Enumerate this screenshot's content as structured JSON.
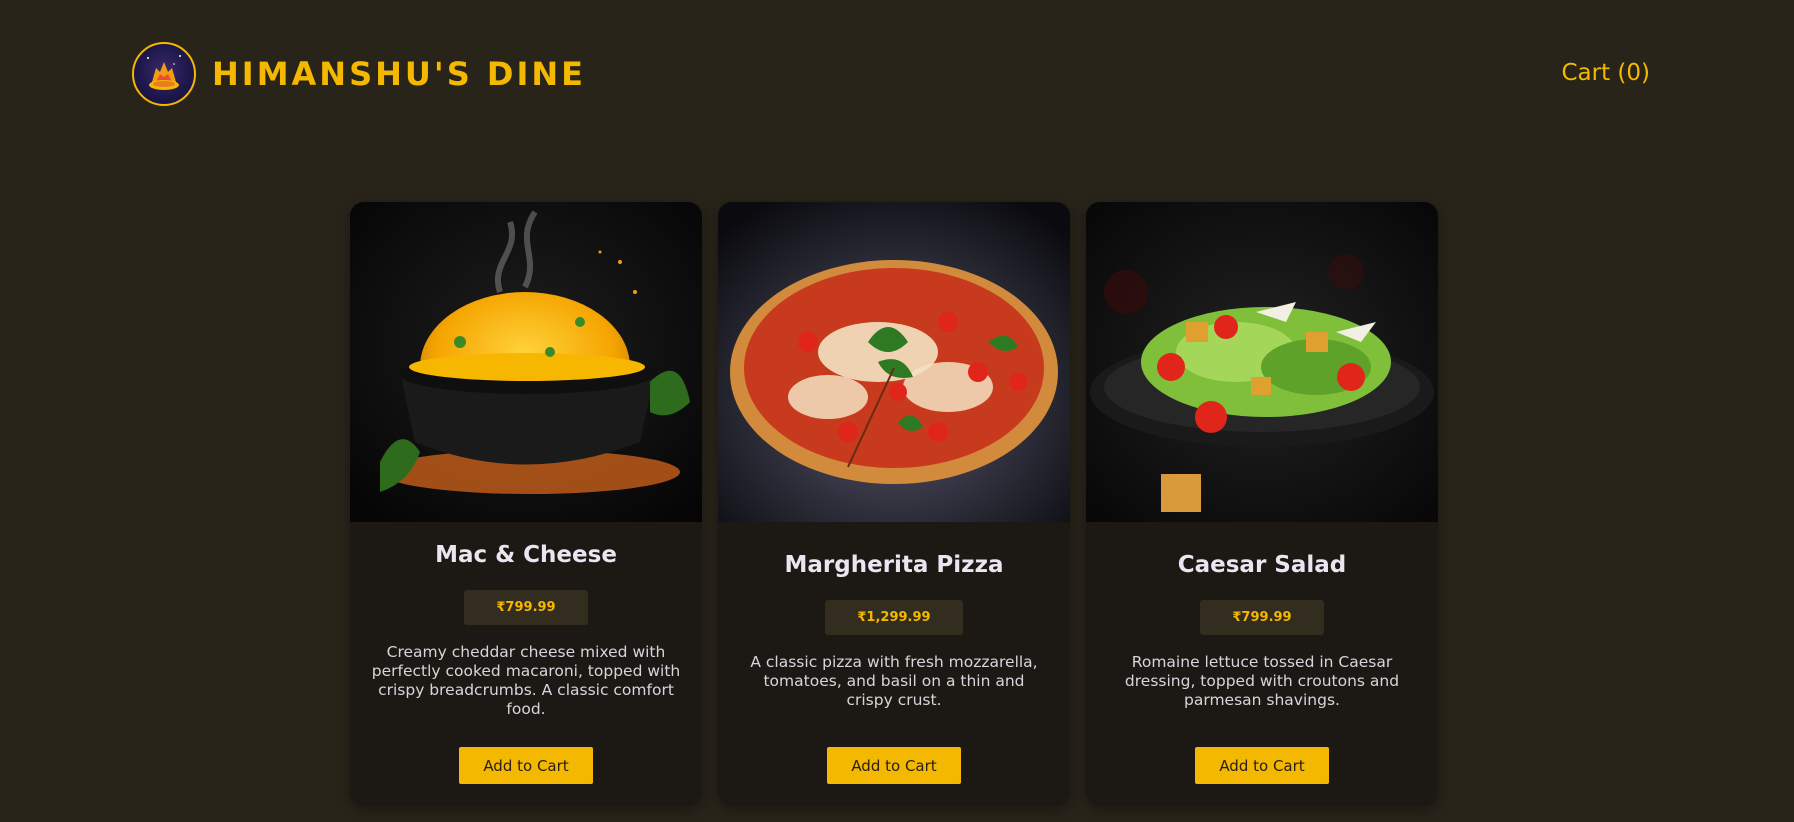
{
  "header": {
    "brand": "HIMANSHU'S DINE",
    "cart_label": "Cart (0)"
  },
  "colors": {
    "background": "#29241a",
    "card": "#1c1914",
    "accent": "#f5b800",
    "price_badge": "#332d20"
  },
  "menu": [
    {
      "title": "Mac & Cheese",
      "price": "₹799.99",
      "description": "Creamy cheddar cheese mixed with perfectly cooked macaroni, topped with crispy breadcrumbs. A classic comfort food.",
      "button": "Add to Cart",
      "image": "mac-and-cheese-photo"
    },
    {
      "title": "Margherita Pizza",
      "price": "₹1,299.99",
      "description": "A classic pizza with fresh mozzarella, tomatoes, and basil on a thin and crispy crust.",
      "button": "Add to Cart",
      "image": "margherita-pizza-photo"
    },
    {
      "title": "Caesar Salad",
      "price": "₹799.99",
      "description": "Romaine lettuce tossed in Caesar dressing, topped with croutons and parmesan shavings.",
      "button": "Add to Cart",
      "image": "caesar-salad-photo"
    }
  ]
}
